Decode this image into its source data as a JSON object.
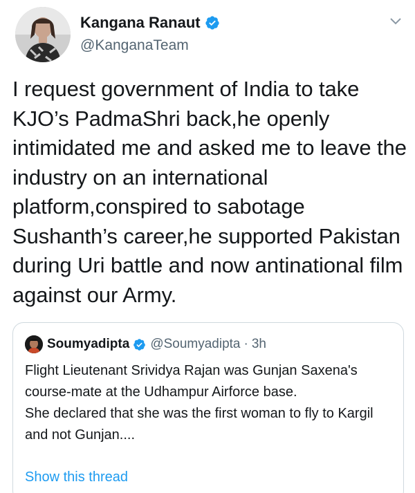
{
  "tweet": {
    "author_name": "Kangana Ranaut",
    "author_handle": "@KanganaTeam",
    "text": "I request government of India to take KJO’s PadmaShri back,he openly intimidated me and asked me to leave the industry on an international platform,conspired to sabotage Sushanth’s career,he supported Pakistan during Uri battle and now antinational film against our Army."
  },
  "quote": {
    "author_name": "Soumyadipta",
    "author_handle": "@Soumyadipta",
    "separator": "·",
    "time": "3h",
    "text_line1": "Flight Lieutenant Srividya Rajan was Gunjan Saxena's course-mate at the Udhampur Airforce base.",
    "text_line2": "She declared that she was the first woman to fly to Kargil and not Gunjan....",
    "show_thread_label": "Show this thread"
  },
  "icons": {
    "verified": "verified-badge-icon",
    "more": "chevron-down-icon"
  },
  "colors": {
    "verified_blue": "#1d9bf0",
    "link_blue": "#1d9bf0",
    "secondary_text": "#536471",
    "border": "#cfd9de"
  }
}
